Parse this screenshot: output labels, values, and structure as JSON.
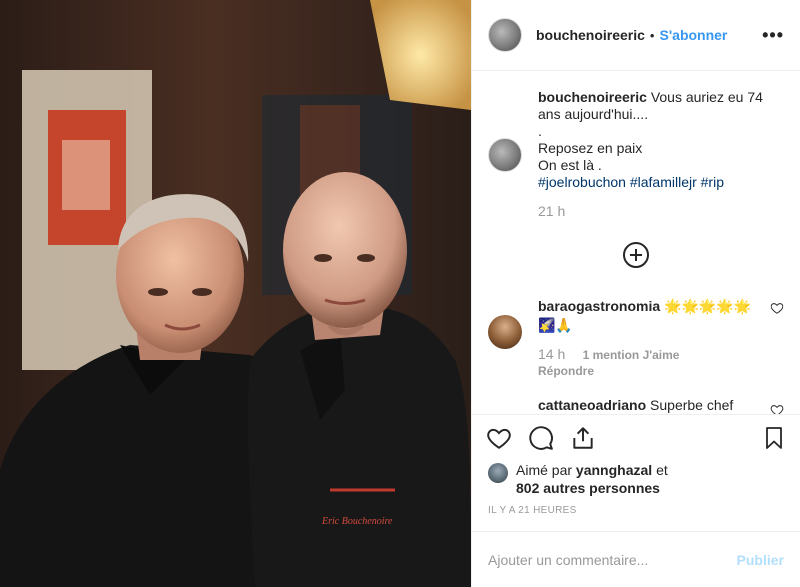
{
  "post": {
    "author": "bouchenoireeric",
    "separator": "•",
    "follow_label": "S'abonner",
    "more_label": "•••"
  },
  "caption": {
    "username": "bouchenoireeric",
    "line1": "Vous auriez eu 74 ans aujourd'hui....",
    "line2": ".",
    "line3": "Reposez en paix",
    "line4": "On est là .",
    "hashtags": "#joelrobuchon #lafamillejr #rip",
    "time": "21 h"
  },
  "comments": [
    {
      "username": "baraogastronomia",
      "text": "🌟🌟🌟🌟🌟 🌠🙏",
      "time": "14 h",
      "likes": "1 mention J'aime",
      "reply": "Répondre"
    },
    {
      "username": "cattaneoadriano",
      "text": "Superbe chef"
    }
  ],
  "likes": {
    "prefix": "Aimé par",
    "user": "yannghazal",
    "conj": "et",
    "others": "802 autres personnes"
  },
  "date": "IL Y A 21 HEURES",
  "add_comment": {
    "placeholder": "Ajouter un commentaire...",
    "publish_label": "Publier"
  },
  "photo": {
    "jacket_embroidery": "Eric Bouchenoire"
  },
  "colors": {
    "link": "#3897f0",
    "hashtag": "#003569",
    "publish_disabled": "#b2dffc",
    "muted": "#999999"
  }
}
